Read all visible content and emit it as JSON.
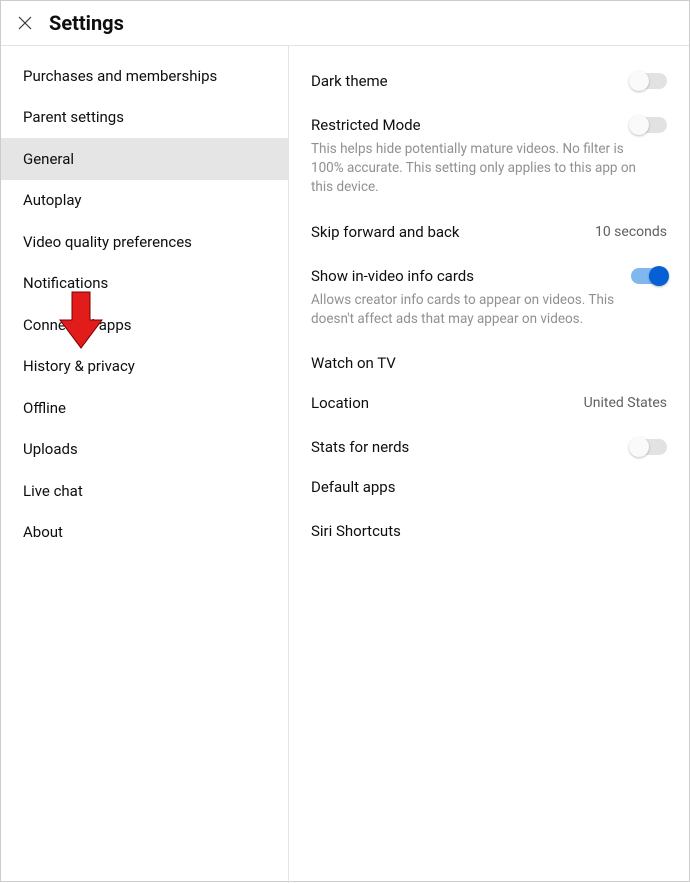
{
  "header": {
    "title": "Settings"
  },
  "sidebar": {
    "items": [
      {
        "label": "Purchases and memberships"
      },
      {
        "label": "Parent settings"
      },
      {
        "label": "General"
      },
      {
        "label": "Autoplay"
      },
      {
        "label": "Video quality preferences"
      },
      {
        "label": "Notifications"
      },
      {
        "label": "Connected apps"
      },
      {
        "label": "History & privacy"
      },
      {
        "label": "Offline"
      },
      {
        "label": "Uploads"
      },
      {
        "label": "Live chat"
      },
      {
        "label": "About"
      }
    ],
    "selected_index": 2
  },
  "main": {
    "dark_theme": {
      "label": "Dark theme",
      "on": false
    },
    "restricted_mode": {
      "label": "Restricted Mode",
      "on": false,
      "desc": "This helps hide potentially mature videos. No filter is 100% accurate. This setting only applies to this app on this device."
    },
    "skip": {
      "label": "Skip forward and back",
      "value": "10 seconds"
    },
    "info_cards": {
      "label": "Show in-video info cards",
      "on": true,
      "desc": "Allows creator info cards to appear on videos. This doesn't affect ads that may appear on videos."
    },
    "watch_tv": {
      "label": "Watch on TV"
    },
    "location": {
      "label": "Location",
      "value": "United States"
    },
    "stats": {
      "label": "Stats for nerds",
      "on": false
    },
    "default_apps": {
      "label": "Default apps"
    },
    "siri": {
      "label": "Siri Shortcuts"
    }
  }
}
